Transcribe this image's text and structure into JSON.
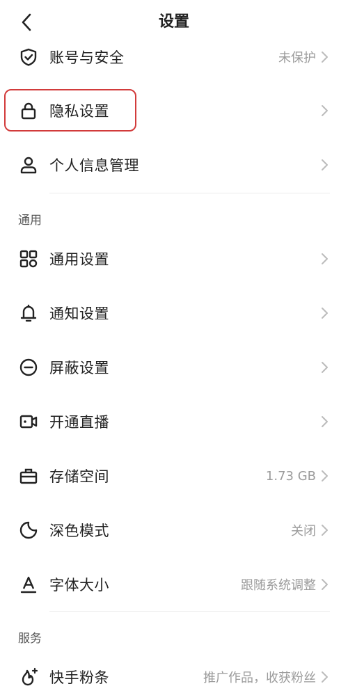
{
  "header": {
    "title": "设置"
  },
  "rows": {
    "account": {
      "label": "账号与安全",
      "value": "未保护"
    },
    "privacy": {
      "label": "隐私设置"
    },
    "personal_info": {
      "label": "个人信息管理"
    },
    "general_settings": {
      "label": "通用设置"
    },
    "notification": {
      "label": "通知设置"
    },
    "block": {
      "label": "屏蔽设置"
    },
    "live": {
      "label": "开通直播"
    },
    "storage": {
      "label": "存储空间",
      "value": "1.73 GB"
    },
    "dark_mode": {
      "label": "深色模式",
      "value": "关闭"
    },
    "font_size": {
      "label": "字体大小",
      "value": "跟随系统调整"
    },
    "fans": {
      "label": "快手粉条",
      "value": "推广作品，收获粉丝"
    }
  },
  "sections": {
    "general": "通用",
    "services": "服务"
  },
  "highlight_color": "#d23b3b"
}
